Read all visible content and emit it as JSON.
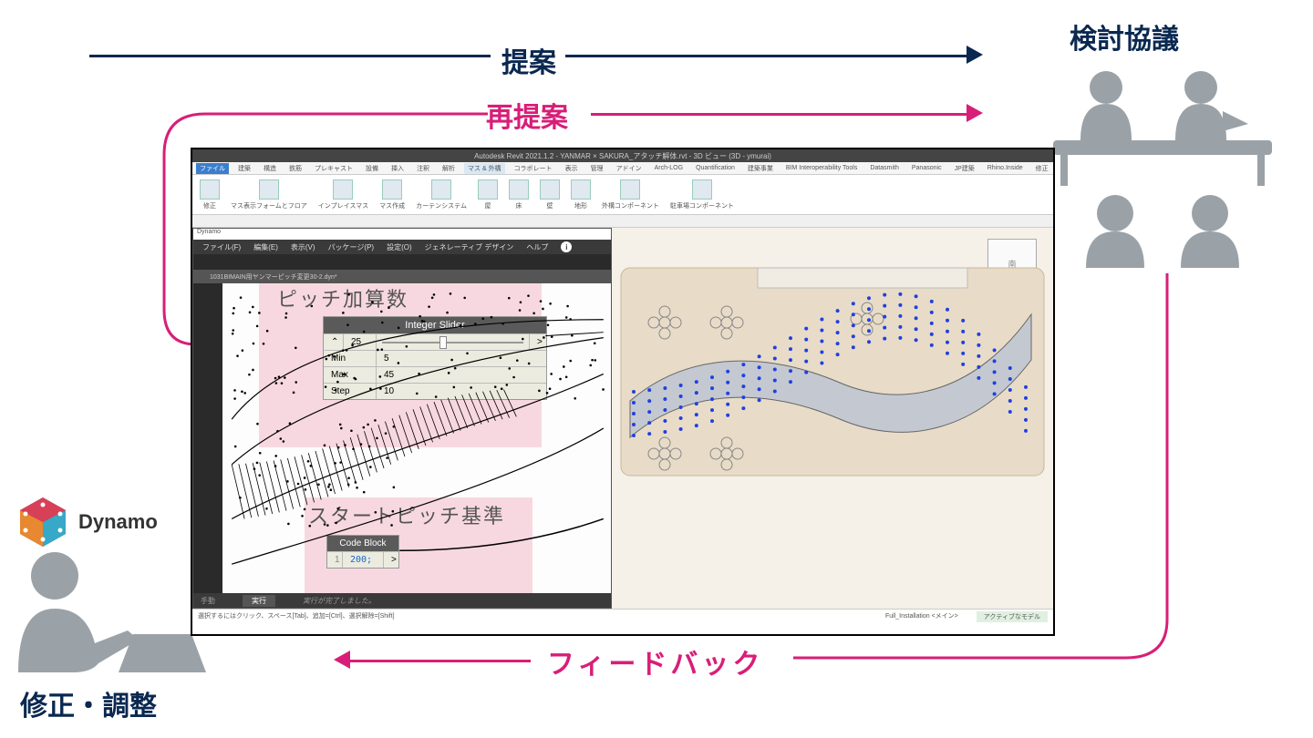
{
  "labels": {
    "proposal": "提案",
    "reproposal": "再提案",
    "feedback": "フィードバック",
    "discussion": "検討協議",
    "modify": "修正・調整",
    "dynamo_ext": "Dynamo"
  },
  "revit": {
    "title": "Autodesk Revit 2021.1.2 - YANMAR × SAKURA_アタッチ解体.rvt - 3D ビュー (3D - ymurai)",
    "user": "ymurai",
    "tabs": [
      "ファイル",
      "建築",
      "構造",
      "鉄筋",
      "プレキャスト",
      "設備",
      "挿入",
      "注釈",
      "解析",
      "マス & 外構",
      "コラボレート",
      "表示",
      "管理",
      "アドイン",
      "Arch-LOG",
      "Quantification",
      "建築事業",
      "BIM Interoperability Tools",
      "Datasmith",
      "Panasonic",
      "JP建築",
      "Rhino.Inside",
      "修正"
    ],
    "active_tab": "マス & 外構",
    "tools": [
      "修正",
      "マス表示フォームとフロア",
      "インプレイスマス",
      "マス作成",
      "カーテンシステム",
      "屋",
      "床",
      "壁",
      "地形",
      "外構コンポーネント",
      "駐車場コンポーネント"
    ],
    "status_hint": "選択するにはクリック、スペース[Tab]、追加=[Ctrl]、選択解除=[Shift]",
    "status_right": "Full_Installation <メイン>",
    "active_model": "アクティブなモデル"
  },
  "dynamo": {
    "window_title": "Dynamo",
    "menus": [
      "ファイル(F)",
      "編集(E)",
      "表示(V)",
      "パッケージ(P)",
      "設定(O)",
      "ジェネレーティブ デザイン",
      "ヘルプ"
    ],
    "tab": "1031BIMAIN用ヤンマーピッチ変更30-2.dyn*",
    "run_mode": "手動",
    "run_btn": "実行",
    "run_status": "実行が完了しました。",
    "label_pitch_add": "ピッチ加算数",
    "label_start_pitch": "スタートピッチ基準",
    "integer_slider": {
      "title": "Integer Slider",
      "value": "25",
      "min_label": "Min",
      "min": "5",
      "max_label": "Max",
      "max": "45",
      "step_label": "Step",
      "step": "10"
    },
    "code_block": {
      "title": "Code Block",
      "line": "1",
      "code": "200;"
    }
  },
  "colors": {
    "navy": "#0a2850",
    "magenta": "#d81e78"
  }
}
